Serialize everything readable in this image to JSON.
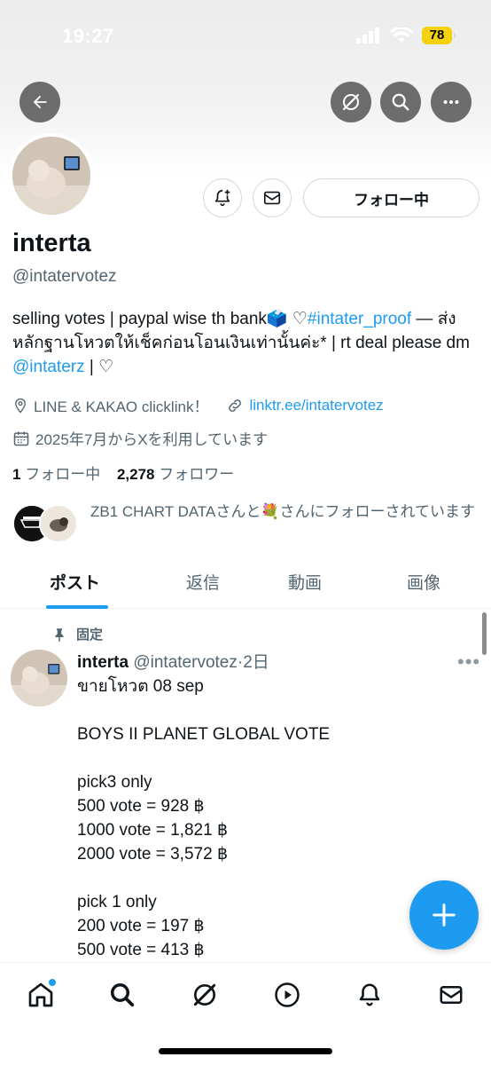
{
  "status_bar": {
    "time": "19:27",
    "battery": "78"
  },
  "profile": {
    "name": "interta",
    "handle": "@intatervotez",
    "follow_button": "フォロー中",
    "bio": {
      "part1": "selling votes | paypal wise th bank🗳️  ♡",
      "hashtag": "#intater_proof",
      "part2": " — ส่งหลักฐานโหวตให้เช็คก่อนโอนเงินเท่านั้นค่ะ* | rt deal please dm ",
      "mention": "@intaterz",
      "part3": " | ♡"
    },
    "location": "LINE & KAKAO  clicklink！",
    "website": "linktr.ee/intatervotez",
    "joined": "2025年7月からXを利用しています",
    "following_count": "1",
    "following_label": "フォロー中",
    "followers_count": "2,278",
    "followers_label": "フォロワー",
    "followed_by": "ZB1 CHART DATAさんと💐さんにフォローされています"
  },
  "tabs": [
    "ポスト",
    "返信",
    "動画",
    "画像"
  ],
  "pinned_post": {
    "pinned_label": "固定",
    "author_name": "interta",
    "author_handle": "@intatervotez",
    "time": "·2日",
    "more": "•••",
    "body": "ขายโหวต 08 sep\n\nBOYS II PLANET  GLOBAL VOTE\n\npick3 only\n500 vote = 928 ฿\n1000 vote = 1,821 ฿\n2000 vote = 3,572 ฿\n\npick 1 only\n200 vote = 197 ฿\n500 vote = 413 ฿"
  },
  "icons": {
    "header": [
      "back-arrow-icon",
      "grok-icon",
      "search-icon",
      "more-icon"
    ],
    "profile": [
      "notification-add-icon",
      "message-icon",
      "location-icon",
      "link-icon",
      "calendar-icon"
    ],
    "nav": [
      "home-icon",
      "search-icon",
      "grok-icon",
      "video-icon",
      "notifications-icon",
      "messages-icon"
    ]
  },
  "colors": {
    "accent": "#1d9bf0",
    "secondary_text": "#536471",
    "battery": "#f5d10d"
  }
}
